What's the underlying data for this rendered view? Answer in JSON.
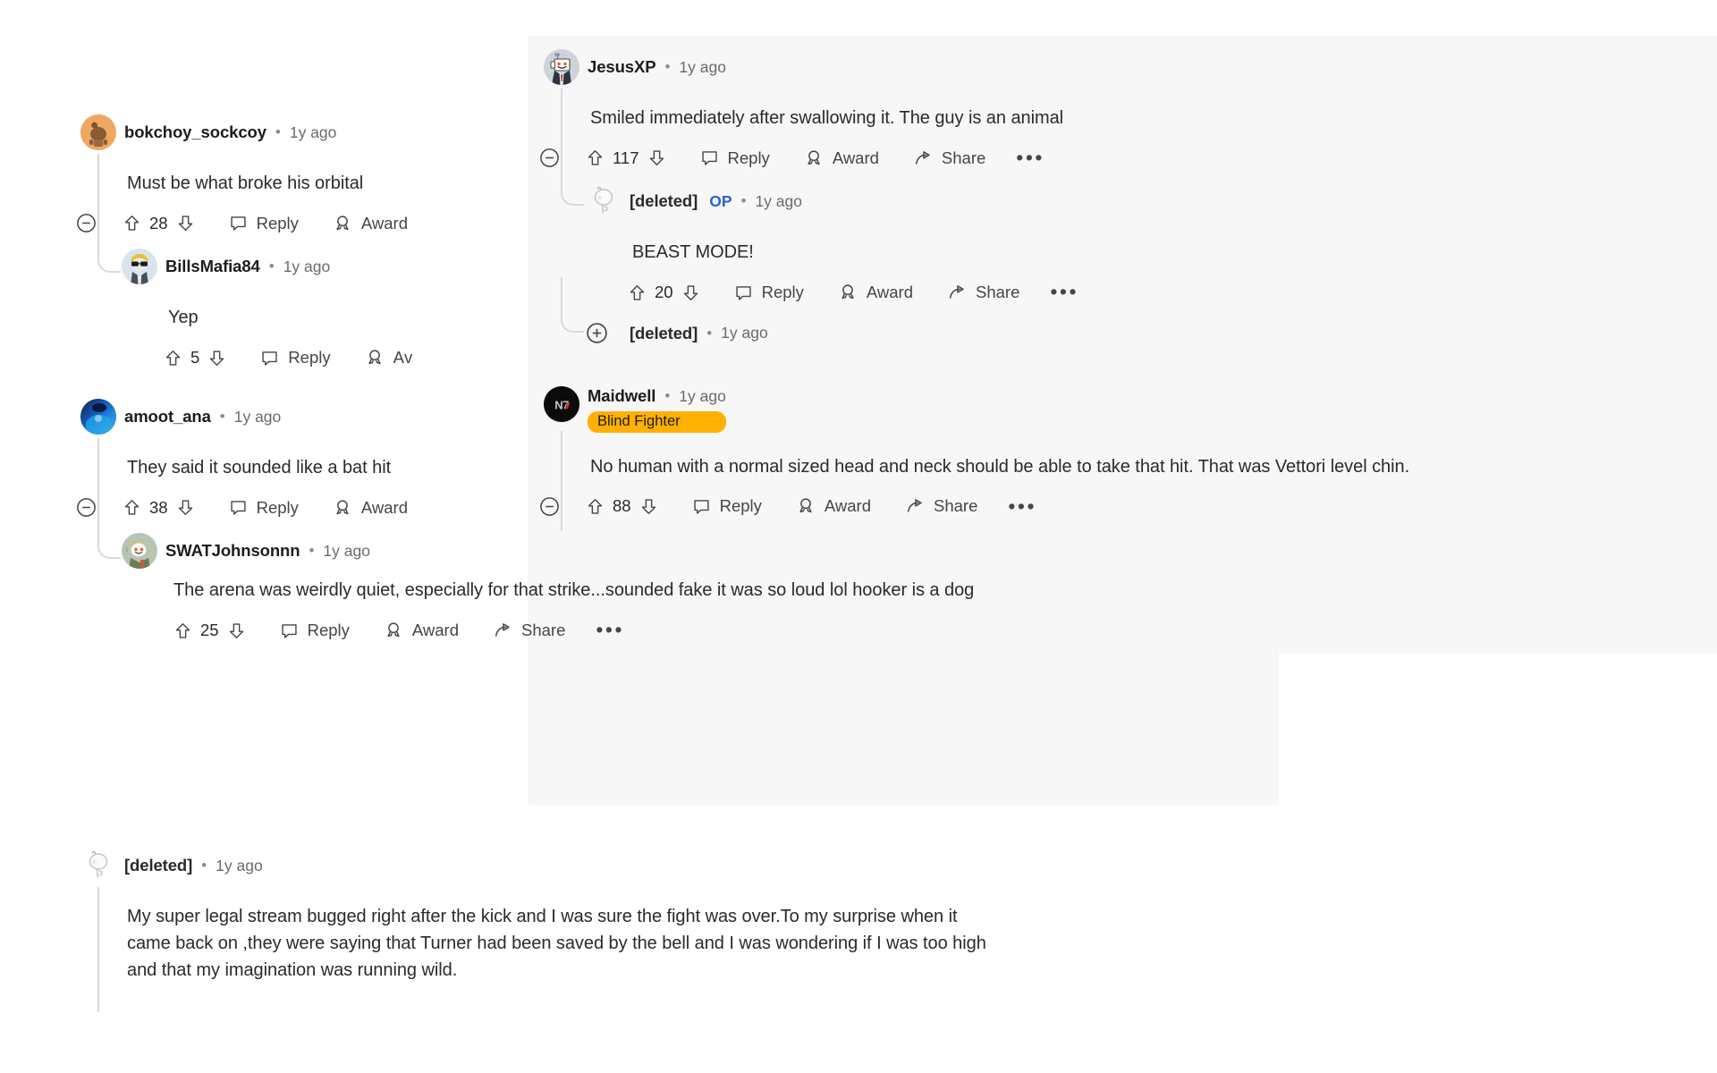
{
  "theme": {
    "page_bg": "#ffffff",
    "panel_bg": "#f7f7f8",
    "text": "#2a2a2d",
    "muted": "#6b6b6b",
    "link": "#2563d6",
    "flair_bg": "#ffb000",
    "line": "#d9dadc"
  },
  "labels": {
    "reply": "Reply",
    "award": "Award",
    "share": "Share",
    "award_clipped": "Aᴠ",
    "more": "•••",
    "op": "OP",
    "separator": "•"
  },
  "left_panel": {
    "comments": [
      {
        "id": "bokchoy",
        "username": "bokchoy_sockcoy",
        "timestamp": "1y ago",
        "body": "Must be what broke his orbital",
        "score": "28",
        "actions": [
          "Reply",
          "Award"
        ],
        "collapse": "collapse"
      },
      {
        "id": "billsmafia",
        "username": "BillsMafia84",
        "timestamp": "1y ago",
        "body": "Yep",
        "score": "5",
        "actions": [
          "Reply",
          "Aᴠ"
        ]
      },
      {
        "id": "amoot",
        "username": "amoot_ana",
        "timestamp": "1y ago",
        "body": "They said it sounded like a bat hit",
        "score": "38",
        "actions": [
          "Reply",
          "Award"
        ],
        "collapse": "collapse"
      },
      {
        "id": "swat",
        "username": "SWATJohnsonnn",
        "timestamp": "1y ago",
        "body": "The arena was weirdly quiet, especially for that strike...sounded fake it was so loud lol hooker is a dog",
        "score": "25",
        "actions": [
          "Reply",
          "Award",
          "Share",
          "•••"
        ]
      },
      {
        "id": "deleted-bottom",
        "username": "[deleted]",
        "timestamp": "1y ago",
        "body_line1": "My super legal stream bugged right after the kick and I was sure the fight was over.To my surprise when it",
        "body_line2": "came back on ,they were saying that Turner had been saved by the bell and I was wondering if I was too high",
        "body_line3": "and that my imagination was running wild."
      }
    ]
  },
  "right_panel": {
    "comments": [
      {
        "id": "jesusxp",
        "username": "JesusXP",
        "timestamp": "1y ago",
        "body": "Smiled immediately after swallowing it. The guy is an animal",
        "score": "117",
        "actions": [
          "Reply",
          "Award",
          "Share",
          "•••"
        ],
        "collapse": "collapse"
      },
      {
        "id": "deleted-op",
        "username": "[deleted]",
        "badge": "OP",
        "timestamp": "1y ago",
        "body": "BEAST MODE!",
        "score": "20",
        "actions": [
          "Reply",
          "Award",
          "Share",
          "•••"
        ]
      },
      {
        "id": "deleted-collapsed",
        "username": "[deleted]",
        "timestamp": "1y ago",
        "expand": "expand"
      },
      {
        "id": "maidwell",
        "username": "Maidwell",
        "timestamp": "1y ago",
        "flair": "Blind Fighter",
        "body": "No human with a normal sized head and neck should be able to take that hit. That was Vettori level chin.",
        "score": "88",
        "actions": [
          "Reply",
          "Award",
          "Share",
          "•••"
        ],
        "collapse": "collapse"
      }
    ]
  }
}
